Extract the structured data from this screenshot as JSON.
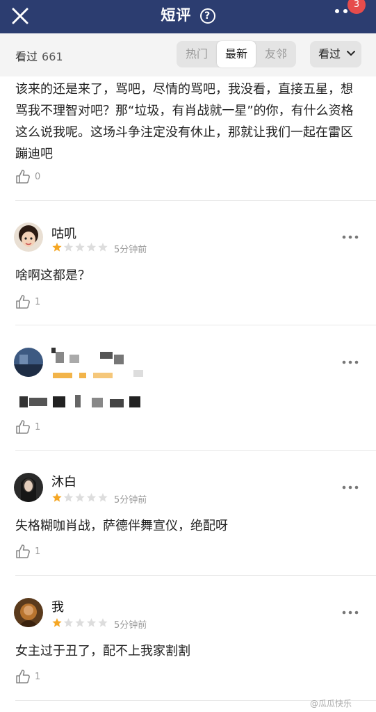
{
  "header": {
    "title": "短评",
    "help_icon": "question-circle-icon",
    "notification_count": "3"
  },
  "filter": {
    "seen_label": "看过",
    "seen_count": "661",
    "tabs": [
      {
        "label": "热门",
        "active": false
      },
      {
        "label": "最新",
        "active": true
      },
      {
        "label": "友邻",
        "active": false
      }
    ],
    "dropdown_label": "看过"
  },
  "reviews": [
    {
      "text": "该来的还是来了，骂吧，尽情的骂吧，我没看，直接五星，想骂我不理智对吧？那“垃圾，有肖战就一星”的你，有什么资格这么说我呢。这场斗争注定没有休止，那就让我们一起在雷区蹦迪吧",
      "likes": "0"
    },
    {
      "user": "咕叽",
      "rating": 1,
      "time": "5分钟前",
      "text": "啥啊这都是？",
      "likes": "1"
    },
    {
      "user": "",
      "rating": 1,
      "time": "",
      "text": "",
      "likes": "1"
    },
    {
      "user": "沐白",
      "rating": 1,
      "time": "5分钟前",
      "text": "失格糊咖肖战，萨德伴舞宣仪，绝配呀",
      "likes": "1"
    },
    {
      "user": "我",
      "rating": 1,
      "time": "5分钟前",
      "text": "女主过于丑了，配不上我家割割",
      "likes": "1"
    }
  ],
  "colors": {
    "header_bg": "#2c3d70",
    "star_active": "#f5a623",
    "star_inactive": "#dddddd",
    "badge": "#e64c4c"
  },
  "watermark": "@瓜瓜快乐"
}
